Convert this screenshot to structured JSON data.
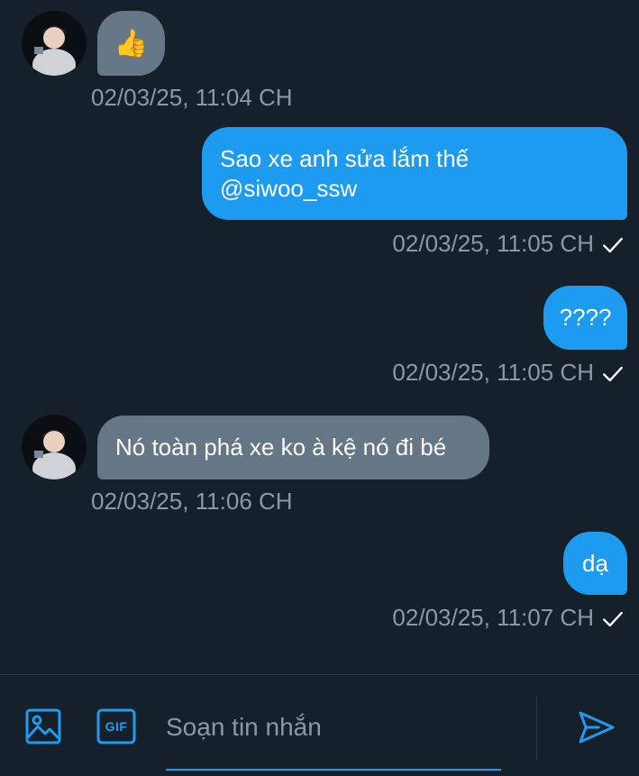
{
  "messages": [
    {
      "direction": "in",
      "type": "emoji",
      "text": "👍",
      "timestamp": "02/03/25, 11:04 CH"
    },
    {
      "direction": "out",
      "type": "text",
      "lines": [
        "Sao xe anh sửa lắm thế",
        "@siwoo_ssw"
      ],
      "timestamp": "02/03/25, 11:05 CH",
      "status": "check-icon"
    },
    {
      "direction": "out",
      "type": "text",
      "text": "????",
      "timestamp": "02/03/25, 11:05 CH",
      "status": "check-icon"
    },
    {
      "direction": "in",
      "type": "text",
      "text": "Nó toàn phá xe ko à kệ nó đi bé",
      "timestamp": "02/03/25, 11:06 CH"
    },
    {
      "direction": "out",
      "type": "text",
      "text": "dạ",
      "timestamp": "02/03/25, 11:07 CH",
      "status": "check-icon"
    }
  ],
  "composer": {
    "placeholder": "Soạn tin nhắn",
    "value": "",
    "image_icon": "image-icon",
    "gif_icon": "gif-icon",
    "gif_label": "GIF",
    "send_icon": "send-icon"
  },
  "colors": {
    "background": "#15202b",
    "incoming_bubble": "#657786",
    "outgoing_bubble": "#1d9bf0",
    "timestamp": "#8b98a5",
    "accent": "#1d9bf0"
  }
}
